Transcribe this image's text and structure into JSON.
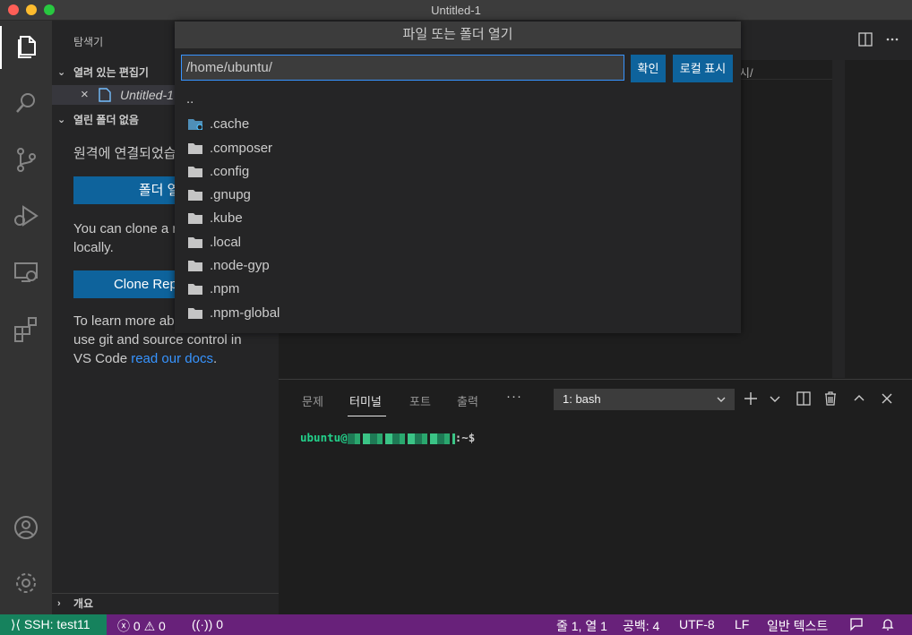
{
  "window": {
    "title": "Untitled-1"
  },
  "sidebar": {
    "title": "탐색기",
    "open_editors_label": "열려 있는 편집기",
    "open_editor_file": "Untitled-1",
    "no_folder_label": "열린 폴더 없음",
    "remote_message": "원격에 연결되었습니다.",
    "open_folder_button": "폴더 열기",
    "clone_message": "You can clone a repository locally.",
    "clone_button": "Clone Repository",
    "learn_text": "To learn more about how to use git and source control in VS Code ",
    "learn_link": "read our docs",
    "learn_period": ".",
    "outline_label": "개요"
  },
  "quick_open": {
    "title": "파일 또는 폴더 열기",
    "path_value": "/home/ubuntu/",
    "ok_button": "확인",
    "show_local_button": "로컬 표시",
    "parent_entry": "..",
    "folders": [
      ".cache",
      ".composer",
      ".config",
      ".gnupg",
      ".kube",
      ".local",
      ".node-gyp",
      ".npm",
      ".npm-global"
    ]
  },
  "editor": {
    "breadcrumb_tail": "시/"
  },
  "panel": {
    "tabs": [
      "문제",
      "터미널",
      "포트",
      "출력"
    ],
    "active_tab": "터미널",
    "more": "···",
    "terminal_select": "1: bash",
    "prompt_user": "ubuntu@",
    "prompt_rest": ":~$"
  },
  "statusbar": {
    "remote": "SSH: test11",
    "errors": "0",
    "warnings": "0",
    "ports": "0",
    "position": "줄 1, 열 1",
    "spaces": "공백: 4",
    "encoding": "UTF-8",
    "eol": "LF",
    "language": "일반 텍스트"
  },
  "colors": {
    "statusbar_bg": "#68217a",
    "remote_bg": "#16825d",
    "button_bg": "#0e639c",
    "focus_border": "#3794ff",
    "terminal_green": "#23d18b"
  }
}
